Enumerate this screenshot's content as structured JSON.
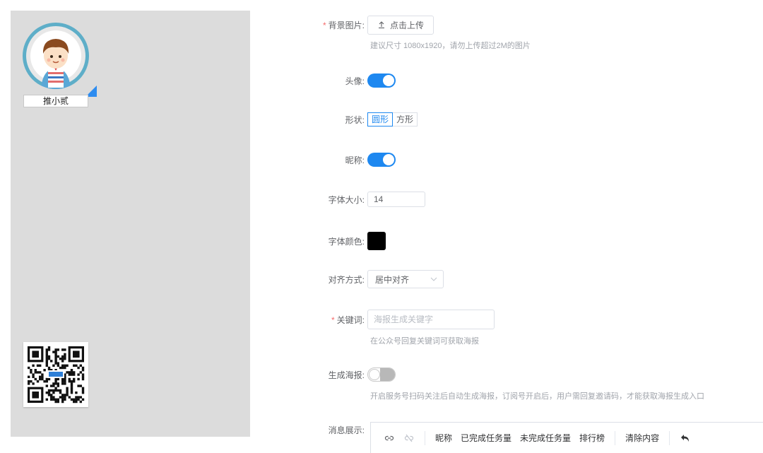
{
  "preview": {
    "nickname": "推小贰"
  },
  "form": {
    "background": {
      "label": "背景图片:",
      "required": "*",
      "upload_label": "点击上传",
      "hint": "建议尺寸 1080x1920，请勿上传超过2M的图片"
    },
    "avatar": {
      "label": "头像:",
      "enabled": true
    },
    "shape": {
      "label": "形状:",
      "options": [
        "圆形",
        "方形"
      ],
      "selected": "圆形"
    },
    "nickname": {
      "label": "昵称:",
      "enabled": true
    },
    "font_size": {
      "label": "字体大小:",
      "value": "14"
    },
    "font_color": {
      "label": "字体颜色:",
      "value": "#000000"
    },
    "align": {
      "label": "对齐方式:",
      "value": "居中对齐"
    },
    "keyword": {
      "label": "关键词:",
      "required": "*",
      "placeholder": "海报生成关键字",
      "hint": "在公众号回复关键词可获取海报"
    },
    "generate": {
      "label": "生成海报:",
      "enabled": false,
      "hint": "开启服务号扫码关注后自动生成海报，订阅号开启后，用户需回复邀请码，才能获取海报生成入口"
    },
    "message": {
      "label": "消息展示:",
      "toolbar": [
        "昵称",
        "已完成任务量",
        "未完成任务量",
        "排行榜",
        "清除内容"
      ]
    }
  },
  "colors": {
    "accent": "#1e88f0",
    "required": "#f56c6c"
  }
}
